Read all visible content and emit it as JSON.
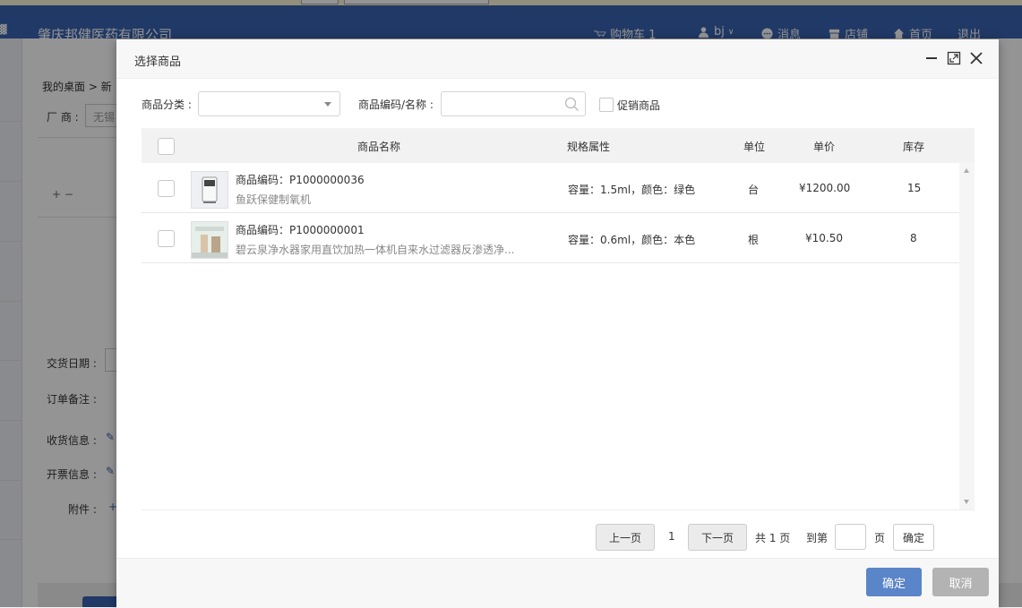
{
  "header": {
    "company": "肇庆邦健医药有限公司",
    "cart": "购物车 1",
    "user": "bj",
    "messages": "消息",
    "store": "店铺",
    "home": "首页",
    "logout": "退出"
  },
  "background": {
    "breadcrumb": "我的桌面 > 新",
    "manufacturer_label": "厂 商 :",
    "manufacturer_value": "无锡",
    "plus_minus": "+ −",
    "delivery_date_label": "交货日期 :",
    "order_note_label": "订单备注 :",
    "receiving_label": "收货信息 :",
    "invoice_label": "开票信息 :",
    "attachment_label": "附件 :"
  },
  "modal": {
    "title": "选择商品",
    "filters": {
      "category_label": "商品分类 :",
      "category_value": "",
      "code_name_label": "商品编码/名称 :",
      "search_value": "",
      "promo_label": "促销商品"
    },
    "columns": [
      "商品名称",
      "规格属性",
      "单位",
      "单价",
      "库存"
    ],
    "rows": [
      {
        "code": "商品编码：P1000000036",
        "name": "鱼跃保健制氧机",
        "spec": "容量：1.5ml，颜色：绿色",
        "unit": "台",
        "price": "¥1200.00",
        "stock": "15"
      },
      {
        "code": "商品编码：P1000000001",
        "name": "碧云泉净水器家用直饮加热一体机自来水过滤器反渗透净...",
        "spec": "容量：0.6ml，颜色：本色",
        "unit": "根",
        "price": "¥10.50",
        "stock": "8"
      }
    ],
    "pagination": {
      "prev": "上一页",
      "current": "1",
      "next": "下一页",
      "total": "共 1 页",
      "goto": "到第",
      "page_unit": "页",
      "confirm": "确定"
    },
    "footer": {
      "ok": "确定",
      "cancel": "取消"
    }
  },
  "colors": {
    "header_bg": "#3a63b0",
    "ok_button": "#5b85c9",
    "cancel_button": "#b3b3b3"
  }
}
